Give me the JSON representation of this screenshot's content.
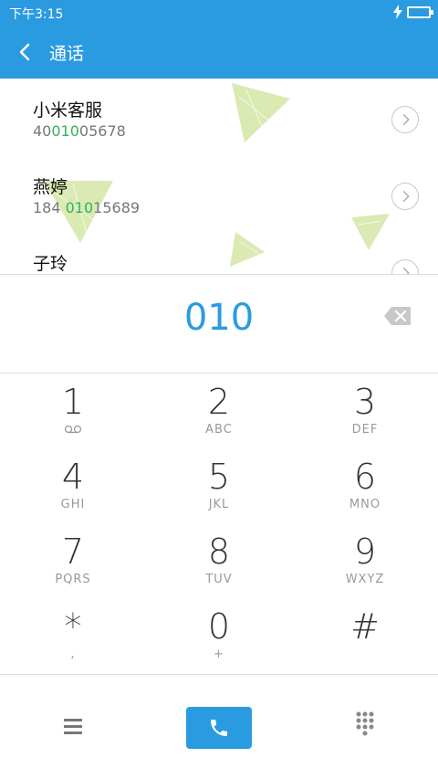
{
  "status_bar": {
    "time": "下午3:15"
  },
  "app_bar": {
    "title": "通话"
  },
  "contacts": [
    {
      "name": "小米客服",
      "number_prefix": "40",
      "number_match": "010",
      "number_suffix": "05678"
    },
    {
      "name": "燕婷",
      "number_prefix": "184 ",
      "number_match": "010",
      "number_suffix": "15689"
    },
    {
      "name": "子玲",
      "number_prefix": "",
      "number_match": "",
      "number_suffix": ""
    }
  ],
  "dialed": {
    "digits": "010"
  },
  "keypad": [
    {
      "main": "1",
      "sub": "voicemail-icon"
    },
    {
      "main": "2",
      "sub": "ABC"
    },
    {
      "main": "3",
      "sub": "DEF"
    },
    {
      "main": "4",
      "sub": "GHI"
    },
    {
      "main": "5",
      "sub": "JKL"
    },
    {
      "main": "6",
      "sub": "MNO"
    },
    {
      "main": "7",
      "sub": "PQRS"
    },
    {
      "main": "8",
      "sub": "TUV"
    },
    {
      "main": "9",
      "sub": "WXYZ"
    },
    {
      "main": "*",
      "sub": ","
    },
    {
      "main": "0",
      "sub": "+"
    },
    {
      "main": "#",
      "sub": ""
    }
  ],
  "colors": {
    "accent": "#2a9be0",
    "match": "#2fb45a",
    "decor": "#d4e6a5"
  },
  "icons": [
    "back-icon",
    "charging-icon",
    "battery-icon",
    "chevron-right-icon",
    "backspace-icon",
    "voicemail-icon",
    "menu-icon",
    "phone-icon",
    "dialpad-icon"
  ]
}
